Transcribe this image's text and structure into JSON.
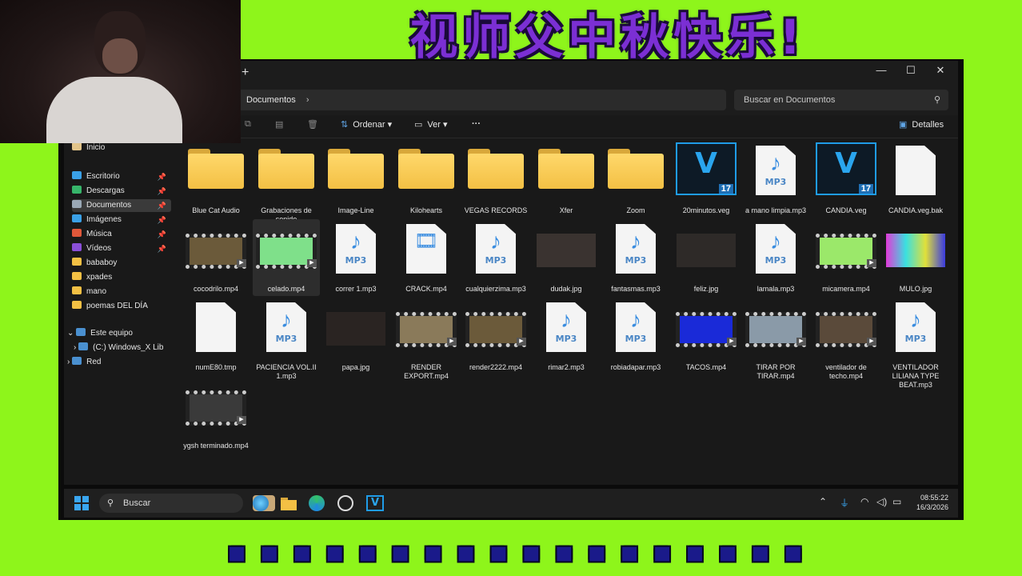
{
  "overlay": {
    "top_text": "视师父中秋快乐!",
    "bottom_text": "▪ ▪ ▪ ▪ ▪ ▪ ▪ ▪ ▪ ▪ ▪ ▪ ▪ ▪ ▪ ▪ ▪ ▪"
  },
  "window": {
    "new_tab": "+",
    "controls": {
      "minimize": "—",
      "maximize": "☐",
      "close": "✕"
    },
    "breadcrumb": {
      "location": "Documentos",
      "chevron": "›"
    },
    "search_placeholder": "Buscar en Documentos",
    "toolbar": {
      "sort_label": "Ordenar",
      "view_label": "Ver",
      "more": "···",
      "details_label": "Detalles"
    }
  },
  "sidebar": {
    "items": [
      {
        "label": "Inicio",
        "icon": "home-icon",
        "color": "#e2c48a",
        "pinned": false
      },
      {
        "label": "Escritorio",
        "icon": "desktop-icon",
        "color": "#3aa0e6",
        "pinned": true
      },
      {
        "label": "Descargas",
        "icon": "download-icon",
        "color": "#37b56a",
        "pinned": true
      },
      {
        "label": "Documentos",
        "icon": "documents-icon",
        "color": "#9aa8b5",
        "pinned": true,
        "active": true
      },
      {
        "label": "Imágenes",
        "icon": "images-icon",
        "color": "#3aa0e6",
        "pinned": true
      },
      {
        "label": "Música",
        "icon": "music-icon",
        "color": "#e0583a",
        "pinned": true
      },
      {
        "label": "Vídeos",
        "icon": "videos-icon",
        "color": "#8a4fd8",
        "pinned": true
      },
      {
        "label": "bababoy",
        "icon": "folder-icon",
        "color": "#f3c044",
        "pinned": false
      },
      {
        "label": "xpades",
        "icon": "folder-icon",
        "color": "#f3c044",
        "pinned": false
      },
      {
        "label": "mano",
        "icon": "folder-icon",
        "color": "#f3c044",
        "pinned": false
      },
      {
        "label": "poemas DEL DÍA",
        "icon": "folder-icon",
        "color": "#f3c044",
        "pinned": false
      }
    ],
    "tree": [
      {
        "label": "Este equipo",
        "icon": "pc-icon",
        "expanded": true
      },
      {
        "label": "(C:) Windows_X Lib",
        "icon": "drive-icon",
        "expanded": false
      },
      {
        "label": "Red",
        "icon": "network-icon",
        "expanded": false
      }
    ]
  },
  "files": [
    {
      "name": "Blue Cat Audio",
      "kind": "folder"
    },
    {
      "name": "Grabaciones de sonido",
      "kind": "folder"
    },
    {
      "name": "Image-Line",
      "kind": "folder"
    },
    {
      "name": "Kilohearts",
      "kind": "folder"
    },
    {
      "name": "VEGAS RECORDS",
      "kind": "folder"
    },
    {
      "name": "Xfer",
      "kind": "folder"
    },
    {
      "name": "Zoom",
      "kind": "folder"
    },
    {
      "name": "20minutos.veg",
      "kind": "veg",
      "v": "V",
      "n": "17"
    },
    {
      "name": "a mano limpia.mp3",
      "kind": "mp3"
    },
    {
      "name": "CANDIA.veg",
      "kind": "veg",
      "v": "V",
      "n": "17"
    },
    {
      "name": "CANDIA.veg.bak",
      "kind": "blank"
    },
    {
      "name": "cocodrilo.mp4",
      "kind": "video",
      "scene": "#6b5a3a"
    },
    {
      "name": "celado.mp4",
      "kind": "video",
      "scene": "#7fe08a",
      "selected": true
    },
    {
      "name": "correr 1.mp3",
      "kind": "mp3"
    },
    {
      "name": "CRACK.mp4",
      "kind": "crack"
    },
    {
      "name": "cualquierzima.mp3",
      "kind": "mp3"
    },
    {
      "name": "dudak.jpg",
      "kind": "photo",
      "scene": "#3a3330"
    },
    {
      "name": "fantasmas.mp3",
      "kind": "mp3"
    },
    {
      "name": "feliz.jpg",
      "kind": "photo",
      "scene": "#2e2a28"
    },
    {
      "name": "lamala.mp3",
      "kind": "mp3"
    },
    {
      "name": "micamera.mp4",
      "kind": "video",
      "scene": "#9be86a"
    },
    {
      "name": "MULO.jpg",
      "kind": "photo",
      "scene": "linear-gradient(90deg,#e03ad8,#3ae0e0,#e0e03a,#3a3ae0)"
    },
    {
      "name": "numE80.tmp",
      "kind": "blank"
    },
    {
      "name": "PACIENCIA VOL.II 1.mp3",
      "kind": "mp3"
    },
    {
      "name": "papa.jpg",
      "kind": "photo",
      "scene": "#2a2422"
    },
    {
      "name": "RENDER EXPORT.mp4",
      "kind": "video",
      "scene": "#8a7a5a"
    },
    {
      "name": "render2222.mp4",
      "kind": "video",
      "scene": "#6b5a3a"
    },
    {
      "name": "rimar2.mp3",
      "kind": "mp3"
    },
    {
      "name": "robiadapar.mp3",
      "kind": "mp3"
    },
    {
      "name": "TACOS.mp4",
      "kind": "video",
      "scene": "#1a2ad8"
    },
    {
      "name": "TIRAR POR TIRAR.mp4",
      "kind": "video",
      "scene": "#8a9aa8"
    },
    {
      "name": "ventilador de techo.mp4",
      "kind": "video",
      "scene": "#5a4a3a"
    },
    {
      "name": "VENTILADOR LILIANA TYPE BEAT.mp3",
      "kind": "mp3"
    },
    {
      "name": "ygsh terminado.mp4",
      "kind": "video",
      "scene": "#3a3a3a"
    }
  ],
  "taskbar": {
    "search_label": "Buscar",
    "clock_time": "08:55:22",
    "clock_date": "16/3/2026",
    "apps": [
      "start-icon",
      "widgets-icon",
      "file-explorer-icon",
      "edge-icon",
      "obs-icon",
      "vegas-icon"
    ]
  }
}
